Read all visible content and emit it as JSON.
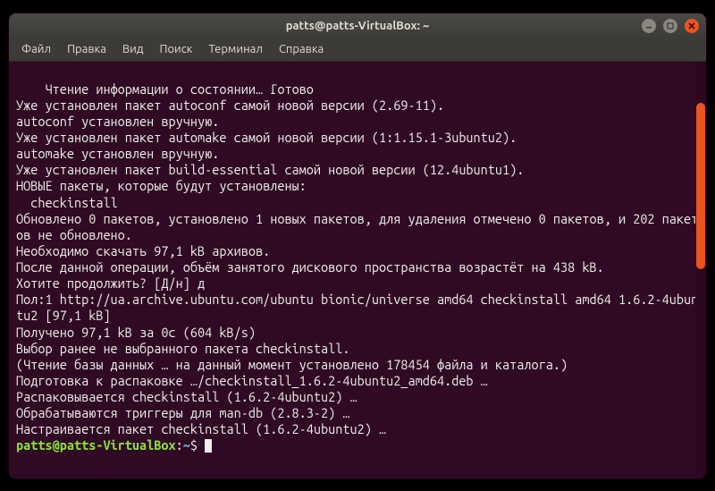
{
  "window": {
    "title": "patts@patts-VirtualBox: ~"
  },
  "menubar": {
    "items": [
      "Файл",
      "Правка",
      "Вид",
      "Поиск",
      "Терминал",
      "Справка"
    ]
  },
  "terminal": {
    "lines": [
      "Чтение информации о состоянии… Готово",
      "Уже установлен пакет autoconf самой новой версии (2.69-11).",
      "autoconf установлен вручную.",
      "Уже установлен пакет automake самой новой версии (1:1.15.1-3ubuntu2).",
      "automake установлен вручную.",
      "Уже установлен пакет build-essential самой новой версии (12.4ubuntu1).",
      "НОВЫЕ пакеты, которые будут установлены:",
      "  checkinstall",
      "Обновлено 0 пакетов, установлено 1 новых пакетов, для удаления отмечено 0 пакетов, и 202 пакетов не обновлено.",
      "Необходимо скачать 97,1 kB архивов.",
      "После данной операции, объём занятого дискового пространства возрастёт на 438 kB.",
      "Хотите продолжить? [Д/н] д",
      "Пол:1 http://ua.archive.ubuntu.com/ubuntu bionic/universe amd64 checkinstall amd64 1.6.2-4ubuntu2 [97,1 kB]",
      "Получено 97,1 kB за 0с (604 kB/s)",
      "Выбор ранее не выбранного пакета checkinstall.",
      "(Чтение базы данных … на данный момент установлено 178454 файла и каталога.)",
      "Подготовка к распаковке …/checkinstall_1.6.2-4ubuntu2_amd64.deb …",
      "Распаковывается checkinstall (1.6.2-4ubuntu2) …",
      "Обрабатываются триггеры для man-db (2.8.3-2) …",
      "Настраивается пакет checkinstall (1.6.2-4ubuntu2) …"
    ],
    "prompt": {
      "user_host": "patts@patts-VirtualBox",
      "sep1": ":",
      "path": "~",
      "sep2": "$ "
    }
  },
  "scrollbar": {
    "thumb_top_pct": 10,
    "thumb_height_pct": 40
  }
}
